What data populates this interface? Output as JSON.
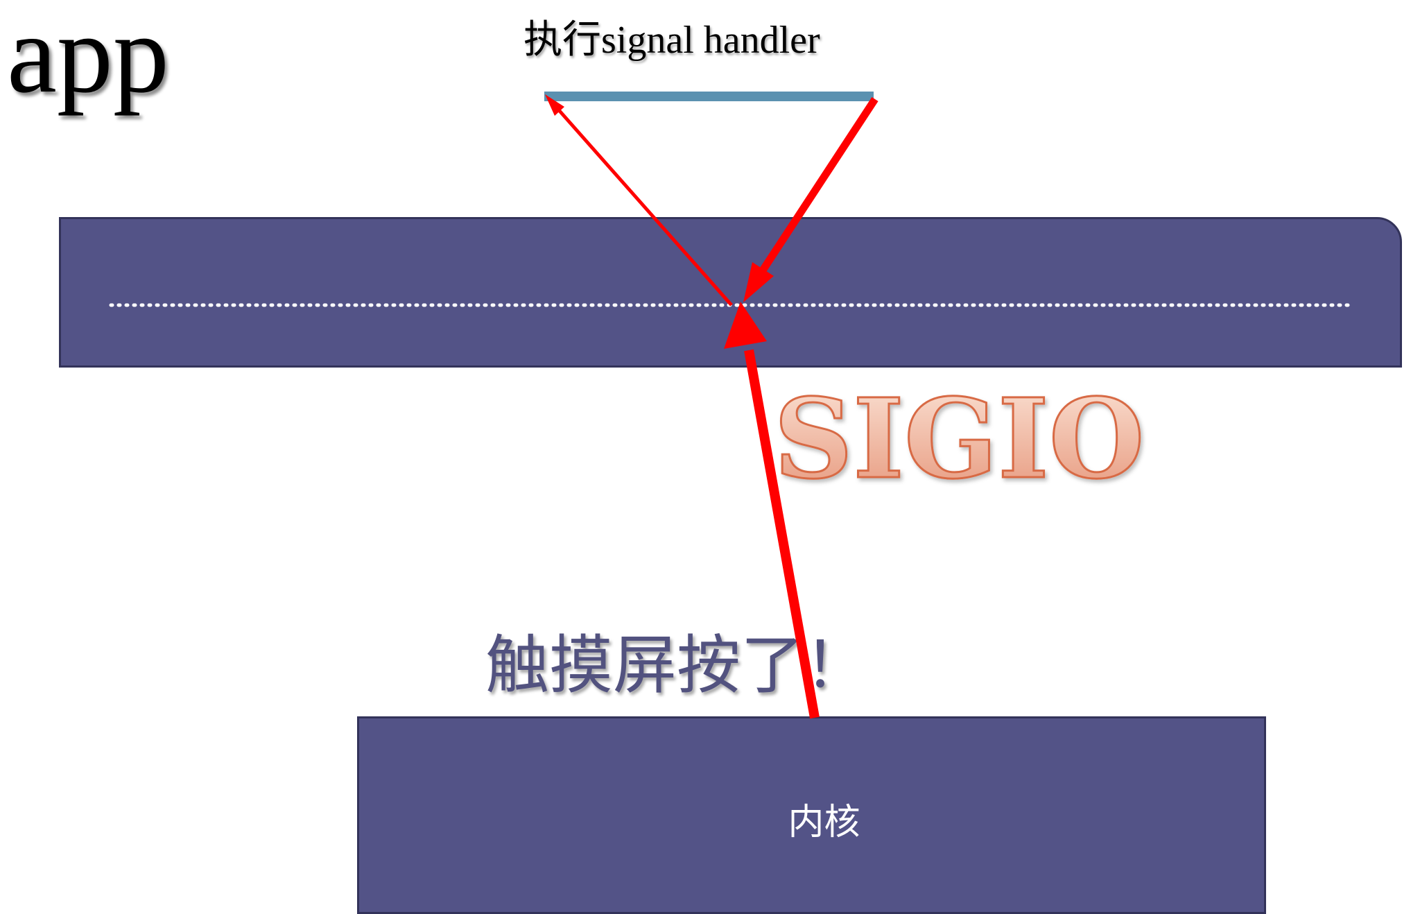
{
  "diagram": {
    "app_label": "app",
    "handler_label": "执行signal handler",
    "signal_label": "SIGIO",
    "event_label": "触摸屏按了！",
    "kernel_label": "内核"
  },
  "colors": {
    "bar_fill": "#535387",
    "bar_border": "#33335a",
    "handler_line": "#5b91b0",
    "arrow": "#ff0000",
    "signal_fill_top": "#fbe3d6",
    "signal_fill_bottom": "#e6967a",
    "signal_stroke": "#d86a44",
    "dotted_line": "#ffffff"
  }
}
